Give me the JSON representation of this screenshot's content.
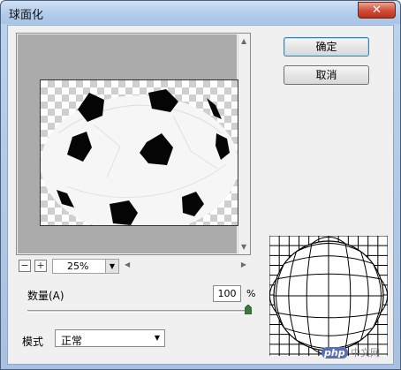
{
  "window": {
    "title": "球面化",
    "close_glyph": "✕"
  },
  "buttons": {
    "ok": "确定",
    "cancel": "取消"
  },
  "preview": {
    "zoom_out": "−",
    "zoom_in": "+",
    "zoom_value": "25%"
  },
  "amount": {
    "label": "数量(A)",
    "value": "100",
    "unit": "%",
    "slider_fraction": 1.0
  },
  "mode": {
    "label": "模式",
    "selected": "正常"
  },
  "watermark": {
    "badge": "php",
    "text": "中文网"
  },
  "icons": [
    "close-icon",
    "scroll-up-icon",
    "scroll-down-icon",
    "scroll-left-icon",
    "scroll-right-icon",
    "dropdown-arrow-icon",
    "slider-thumb-icon"
  ],
  "colors": {
    "titlebar": "#b1cbea",
    "close": "#d2523c",
    "preview_bg": "#ababab"
  }
}
